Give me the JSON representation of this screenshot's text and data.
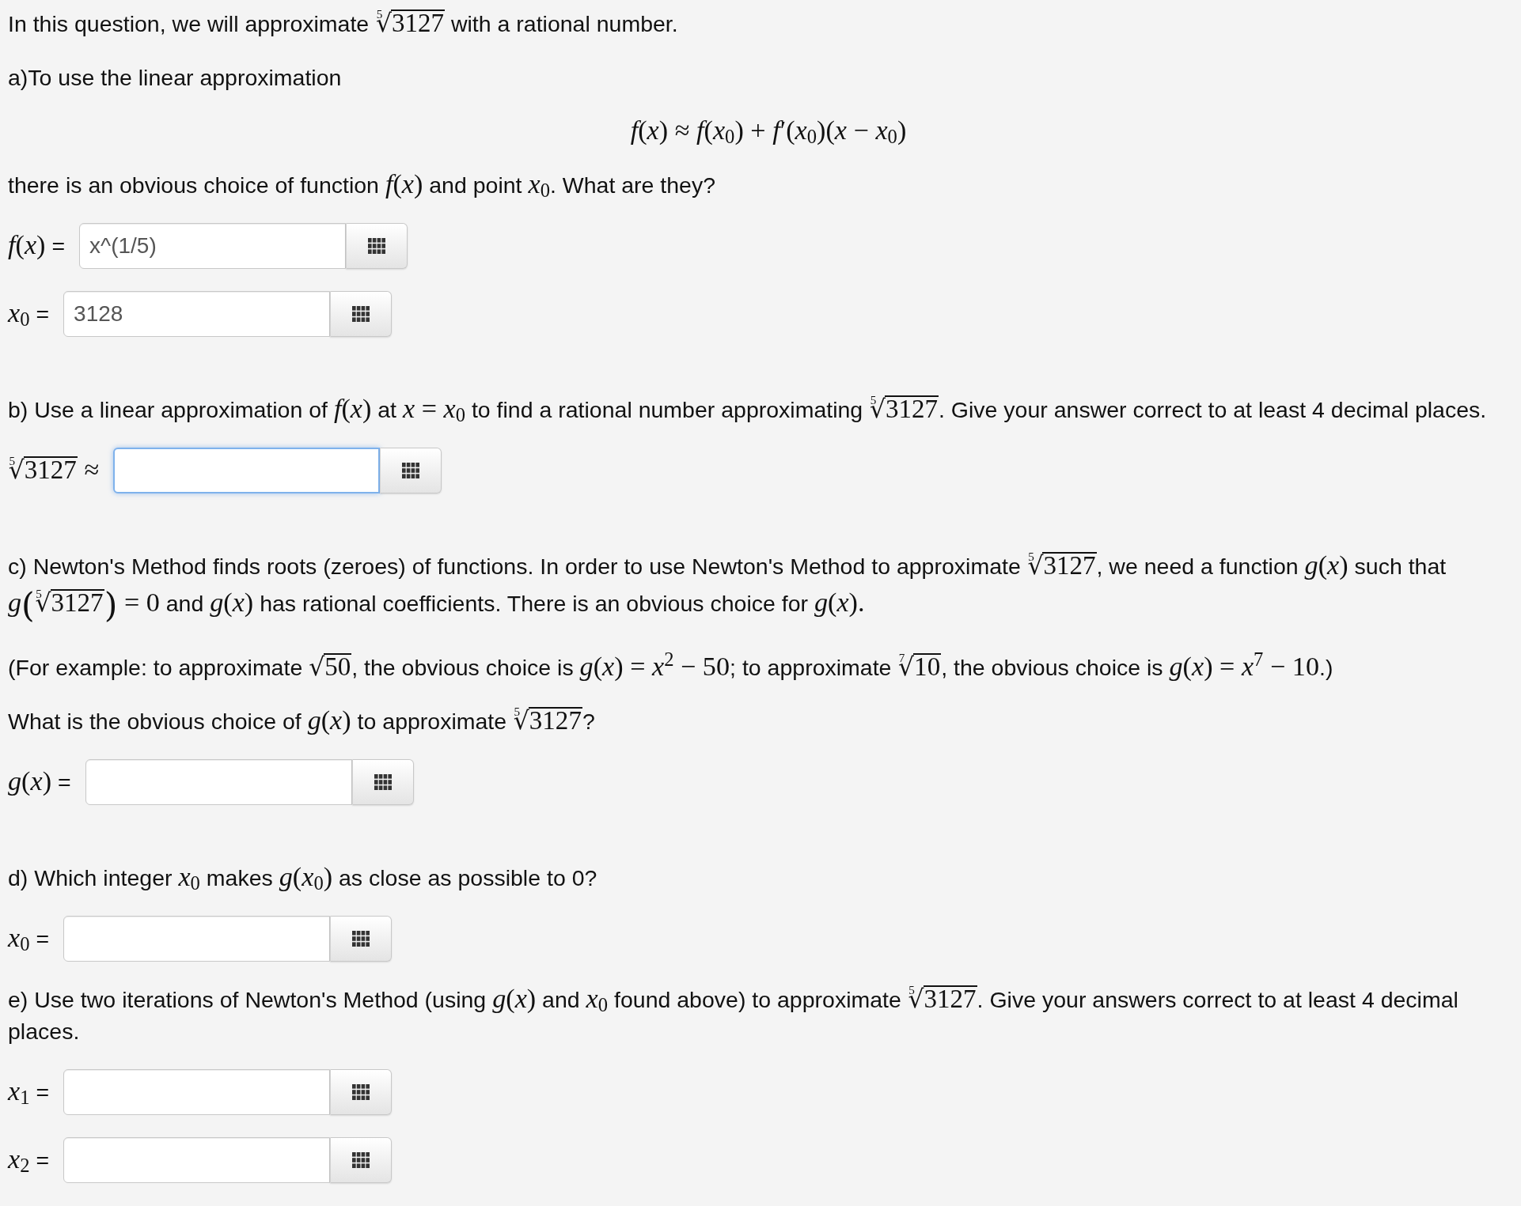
{
  "sections": [
    {
      "blocks": [
        {
          "kind": "paragraph",
          "segments": [
            {
              "kind": "text",
              "text": "In this question, we will approximate "
            },
            {
              "kind": "root",
              "index": "5",
              "sign": "√",
              "radicand": "3127"
            },
            {
              "kind": "text",
              "text": " with a rational number."
            }
          ]
        },
        {
          "kind": "paragraph",
          "segments": [
            {
              "kind": "text",
              "text": "a)To use the linear approximation"
            }
          ]
        },
        {
          "kind": "display",
          "segments": [
            {
              "kind": "math",
              "text": "*f*(*x*) ≈ *f*(*x*$_{0}$) + *f*′(*x*$_{0}$)(*x* − *x*$_{0}$)"
            }
          ]
        },
        {
          "kind": "paragraph",
          "segments": [
            {
              "kind": "text",
              "text": "there is an obvious choice of function "
            },
            {
              "kind": "math",
              "text": "*f*(*x*)"
            },
            {
              "kind": "text",
              "text": " and point "
            },
            {
              "kind": "math",
              "text": "*x*$_{0}$"
            },
            {
              "kind": "text",
              "text": ". What are they?"
            }
          ]
        },
        {
          "kind": "answer",
          "label": [
            {
              "kind": "math",
              "text": "*f*(*x*)"
            },
            {
              "kind": "text",
              "text": " ="
            }
          ],
          "value": "x^(1/5)",
          "focused": false
        },
        {
          "kind": "answer",
          "label": [
            {
              "kind": "math",
              "text": "*x*$_{0}$"
            },
            {
              "kind": "text",
              "text": " ="
            }
          ],
          "value": "3128",
          "focused": false
        }
      ]
    },
    {
      "blocks": [
        {
          "kind": "paragraph",
          "segments": [
            {
              "kind": "text",
              "text": "b) Use a linear approximation of "
            },
            {
              "kind": "math",
              "text": "*f*(*x*)"
            },
            {
              "kind": "text",
              "text": " at "
            },
            {
              "kind": "math",
              "text": "*x* = *x*$_{0}$"
            },
            {
              "kind": "text",
              "text": " to find a rational number approximating "
            },
            {
              "kind": "root",
              "index": "5",
              "sign": "√",
              "radicand": "3127"
            },
            {
              "kind": "text",
              "text": ". Give your answer correct to at least 4 decimal places."
            }
          ]
        },
        {
          "kind": "answer",
          "label": [
            {
              "kind": "root",
              "index": "5",
              "sign": "√",
              "radicand": "3127"
            },
            {
              "kind": "math",
              "text": " ≈"
            }
          ],
          "focused": true
        }
      ]
    },
    {
      "blocks": [
        {
          "kind": "paragraph",
          "segments": [
            {
              "kind": "text",
              "text": "c) Newton's Method finds roots (zeroes) of functions. In order to use Newton's Method to approximate "
            },
            {
              "kind": "root",
              "index": "5",
              "sign": "√",
              "radicand": "3127"
            },
            {
              "kind": "text",
              "text": ", we need a function "
            },
            {
              "kind": "math",
              "text": "*g*(*x*)"
            },
            {
              "kind": "text",
              "text": " such that "
            },
            {
              "kind": "math",
              "text": "*g*"
            },
            {
              "kind": "group",
              "open": "(",
              "close": ")",
              "items": [
                {
                  "kind": "root",
                  "index": "5",
                  "sign": "√",
                  "radicand": "3127"
                }
              ]
            },
            {
              "kind": "math",
              "text": " = 0"
            },
            {
              "kind": "text",
              "text": " and "
            },
            {
              "kind": "math",
              "text": "*g*(*x*)"
            },
            {
              "kind": "text",
              "text": " has rational coefficients. There is an obvious choice for "
            },
            {
              "kind": "math",
              "text": "*g*(*x*)."
            }
          ]
        },
        {
          "kind": "paragraph",
          "segments": [
            {
              "kind": "text",
              "text": "(For example: to approximate "
            },
            {
              "kind": "root",
              "sign": "√",
              "radicand": "50"
            },
            {
              "kind": "text",
              "text": ", the obvious choice is "
            },
            {
              "kind": "math",
              "text": "*g*(*x*) = *x*$^{2}$ − 50"
            },
            {
              "kind": "text",
              "text": "; to approximate "
            },
            {
              "kind": "root",
              "index": "7",
              "sign": "√",
              "radicand": "10"
            },
            {
              "kind": "text",
              "text": ", the obvious choice is "
            },
            {
              "kind": "math",
              "text": "*g*(*x*) = *x*$^{7}$ − 10"
            },
            {
              "kind": "text",
              "text": ".)"
            }
          ]
        },
        {
          "kind": "paragraph",
          "segments": [
            {
              "kind": "text",
              "text": "What is the obvious choice of "
            },
            {
              "kind": "math",
              "text": "*g*(*x*)"
            },
            {
              "kind": "text",
              "text": " to approximate "
            },
            {
              "kind": "root",
              "index": "5",
              "sign": "√",
              "radicand": "3127"
            },
            {
              "kind": "text",
              "text": "?"
            }
          ]
        },
        {
          "kind": "answer",
          "label": [
            {
              "kind": "math",
              "text": "*g*(*x*)"
            },
            {
              "kind": "text",
              "text": " ="
            }
          ],
          "focused": false
        }
      ]
    },
    {
      "blocks": [
        {
          "kind": "paragraph",
          "segments": [
            {
              "kind": "text",
              "text": "d) Which integer "
            },
            {
              "kind": "math",
              "text": "*x*$_{0}$"
            },
            {
              "kind": "text",
              "text": " makes "
            },
            {
              "kind": "math",
              "text": "*g*(*x*$_{0}$)"
            },
            {
              "kind": "text",
              "text": " as close as possible to 0?"
            }
          ]
        },
        {
          "kind": "answer",
          "label": [
            {
              "kind": "math",
              "text": "*x*$_{0}$"
            },
            {
              "kind": "text",
              "text": " ="
            }
          ],
          "focused": false
        },
        {
          "kind": "paragraph",
          "segments": [
            {
              "kind": "text",
              "text": "e) Use two iterations of Newton's Method (using "
            },
            {
              "kind": "math",
              "text": "*g*(*x*)"
            },
            {
              "kind": "text",
              "text": " and "
            },
            {
              "kind": "math",
              "text": "*x*$_{0}$"
            },
            {
              "kind": "text",
              "text": " found above) to approximate "
            },
            {
              "kind": "root",
              "index": "5",
              "sign": "√",
              "radicand": "3127"
            },
            {
              "kind": "text",
              "text": ". Give your answers correct to at least 4 decimal places."
            }
          ]
        },
        {
          "kind": "answer",
          "label": [
            {
              "kind": "math",
              "text": "*x*$_{1}$"
            },
            {
              "kind": "text",
              "text": " ="
            }
          ],
          "focused": false
        },
        {
          "kind": "answer",
          "label": [
            {
              "kind": "math",
              "text": "*x*$_{2}$"
            },
            {
              "kind": "text",
              "text": " ="
            }
          ],
          "focused": false
        }
      ]
    }
  ]
}
